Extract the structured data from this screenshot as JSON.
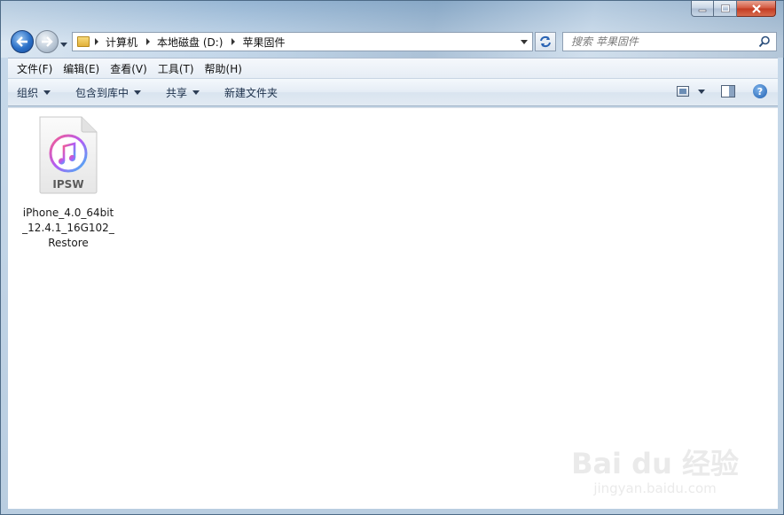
{
  "navigation": {
    "breadcrumb": [
      "计算机",
      "本地磁盘 (D:)",
      "苹果固件"
    ]
  },
  "search": {
    "placeholder": "搜索 苹果固件"
  },
  "menu": {
    "items": [
      "文件(F)",
      "编辑(E)",
      "查看(V)",
      "工具(T)",
      "帮助(H)"
    ]
  },
  "commandbar": {
    "organize": "组织",
    "include_in_library": "包含到库中",
    "share": "共享",
    "new_folder": "新建文件夹"
  },
  "files": [
    {
      "name": "iPhone_4.0_64bit_12.4.1_16G102_Restore",
      "icon_label": "IPSW",
      "icon": "itunes-ipsw-file-icon"
    }
  ],
  "watermark": {
    "logo_text": "Bai du 经验",
    "url": "jingyan.baidu.com"
  },
  "colors": {
    "content_bg": "#ffffff",
    "frame": "#b9cde0",
    "close_button": "#c23a21"
  }
}
